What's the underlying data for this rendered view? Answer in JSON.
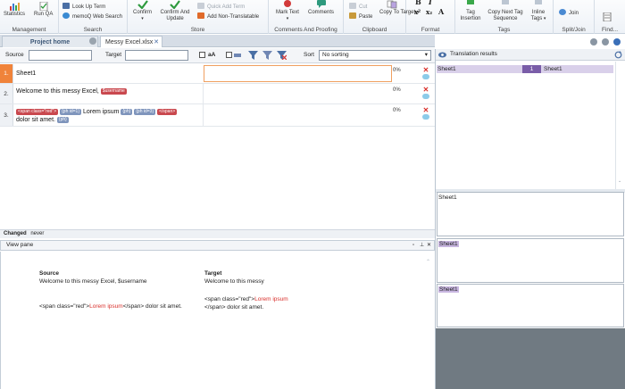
{
  "ribbon": {
    "groups": [
      {
        "id": "management",
        "label": "Management",
        "buttons": [
          "Statistics",
          "Run QA"
        ]
      },
      {
        "id": "search",
        "label": "Search",
        "buttons": [
          "Look Up Term",
          "memoQ Web Search"
        ]
      },
      {
        "id": "store",
        "label": "Store",
        "buttons": [
          "Confirm",
          "Confirm And Update",
          "Quick Add Term",
          "Add Non-Translatable"
        ]
      },
      {
        "id": "comments",
        "label": "Comments And Proofing",
        "buttons": [
          "Mark Text",
          "Comments"
        ]
      },
      {
        "id": "clipboard",
        "label": "Clipboard",
        "buttons": [
          "Cut",
          "Paste",
          "Copy To Target"
        ]
      },
      {
        "id": "format",
        "label": "Format"
      },
      {
        "id": "tags",
        "label": "Tags",
        "buttons": [
          "Tag Insertion",
          "Copy Next Tag Sequence",
          "Inline Tags"
        ]
      },
      {
        "id": "splitjoin",
        "label": "Split/Join",
        "buttons": [
          "Join"
        ]
      },
      {
        "id": "find",
        "label": "Find..."
      }
    ]
  },
  "tabs": {
    "project": "Project home",
    "document": "Messy Excel.xlsx"
  },
  "filter": {
    "source_label": "Source",
    "target_label": "Target",
    "case_label": "aA",
    "sort_label": "Sort",
    "sort_value": "No sorting"
  },
  "rows": [
    {
      "num": "1.",
      "source": "Sheet1",
      "pct": "0%"
    },
    {
      "num": "2.",
      "source": "Welcome to this messy Excel,",
      "tag": "$username",
      "pct": "0%"
    },
    {
      "num": "3.",
      "tag_open_span": "<span class=\"red\">",
      "tag_ph1": "{ph id=1}",
      "lorem": "Lorem ipsum",
      "tag_ph2": "{ph}",
      "tag_ph3": "{ph id=3}",
      "tag_close_span": "</span>",
      "rest": "dolor sit amet.",
      "tag_ph4": "{ph}",
      "pct": "0%"
    }
  ],
  "changed": {
    "label": "Changed",
    "value": "never"
  },
  "view_pane": {
    "title": "View pane",
    "source_heading": "Source",
    "target_heading": "Target",
    "source_line1": "Welcome to this messy Excel, $username",
    "source_line2_a": "<span class=\"red\">",
    "source_line2_red": "Lorem ipsum",
    "source_line2_b": "</span> dolor sit amet.",
    "target_line1": "Welcome to this messy",
    "target_line2_a": "<span class=\"red\">",
    "target_line2_red": "Lorem ipsum",
    "target_line2_b": "</span> dolor sit amet."
  },
  "translation_results": {
    "title": "Translation results",
    "row": {
      "source": "Sheet1",
      "num": "1",
      "target": "Sheet1"
    },
    "pane1": "Sheet1",
    "pane2": "Sheet1",
    "pane3": "Sheet1"
  }
}
